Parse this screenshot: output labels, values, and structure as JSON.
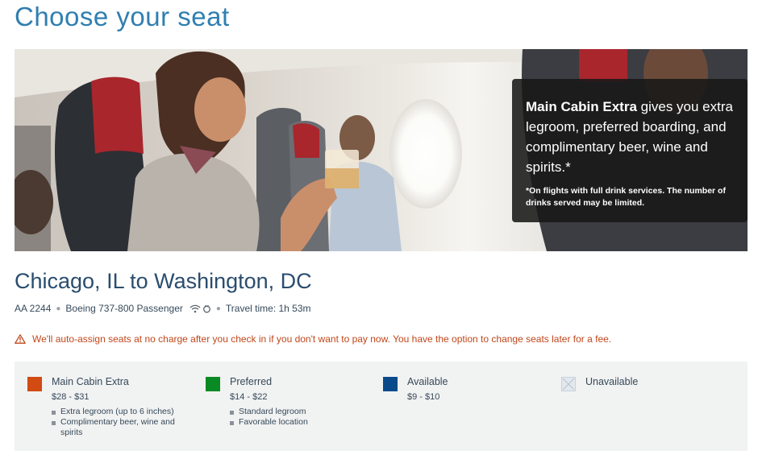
{
  "page": {
    "title": "Choose your seat"
  },
  "hero": {
    "promo_headline_bold": "Main Cabin Extra",
    "promo_headline_rest": " gives you extra legroom, preferred boarding, and complimentary beer, wine and spirits.*",
    "promo_note": "*On flights with full drink services. The number of drinks served may be limited."
  },
  "flight": {
    "route": "Chicago, IL to Washington, DC",
    "number": "AA 2244",
    "aircraft": "Boeing 737-800 Passenger",
    "amenity_icons": [
      "wifi-icon",
      "power-icon"
    ],
    "travel_time": "Travel time: 1h 53m"
  },
  "warning": {
    "icon": "warning-triangle-icon",
    "text": "We'll auto-assign seats at no charge after you check in if you don't want to pay now. You have the option to change seats later for a fee."
  },
  "legend": {
    "items": [
      {
        "label": "Main Cabin Extra",
        "price": "$28 - $31",
        "color": "#d14b12",
        "features": [
          "Extra legroom (up to 6 inches)",
          "Complimentary beer, wine and spirits"
        ]
      },
      {
        "label": "Preferred",
        "price": "$14 - $22",
        "color": "#0a8a23",
        "features": [
          "Standard legroom",
          "Favorable location"
        ]
      },
      {
        "label": "Available",
        "price": "$9 - $10",
        "color": "#0a4a8a",
        "features": []
      },
      {
        "label": "Unavailable",
        "price": "",
        "color": "#e3e8ee",
        "features": []
      }
    ]
  }
}
